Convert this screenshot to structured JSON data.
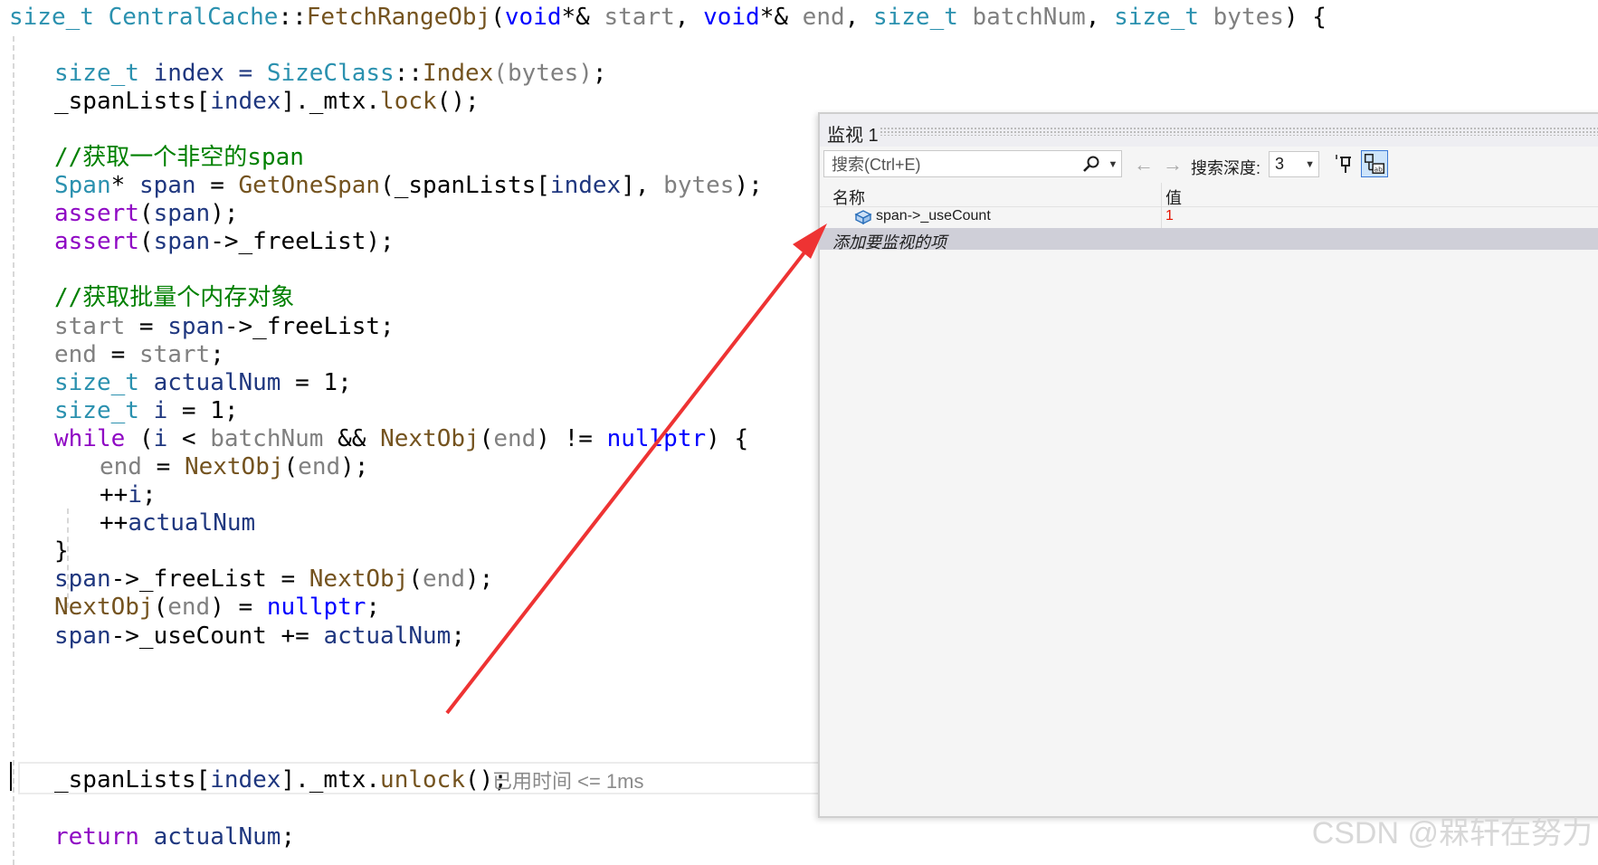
{
  "code": {
    "sig": {
      "ret": "size_t",
      "cls": "CentralCache",
      "sep": "::",
      "fn": "FetchRangeObj",
      "p1t": "void",
      "p1s": "*&",
      "p1n": "start",
      "p2t": "void",
      "p2s": "*&",
      "p2n": "end",
      "p3t": "size_t",
      "p3n": "batchNum",
      "p4t": "size_t",
      "p4n": "bytes",
      "open": "{"
    },
    "l1": {
      "t": "size_t",
      "a": " index = ",
      "cls": "SizeClass",
      "sep": "::",
      "fn": "Index",
      "p": "(bytes)",
      "b": ";"
    },
    "l2": {
      "a": "_spanLists[",
      "idx": "index",
      "b": "]._mtx.",
      "fn": "lock",
      "c": "();"
    },
    "l3": {
      "cm": "//获取一个非空的span"
    },
    "l4": {
      "t": "Span",
      "a": "* ",
      "v": "span",
      "b": " = ",
      "fn": "GetOneSpan",
      "c": "(_spanLists[",
      "idx": "index",
      "d": "], ",
      "p": "bytes",
      "e": ");"
    },
    "l5": {
      "m": "assert",
      "a": "(",
      "v": "span",
      "b": ");"
    },
    "l6": {
      "m": "assert",
      "a": "(",
      "v": "span",
      "b": "->_freeList);"
    },
    "l7": {
      "cm": "//获取批量个内存对象"
    },
    "l8": {
      "p": "start",
      "a": " = ",
      "v": "span",
      "b": "->_freeList;"
    },
    "l9": {
      "p": "end",
      "a": " = ",
      "p2": "start",
      "b": ";"
    },
    "l10": {
      "t": "size_t",
      "a": " ",
      "v": "actualNum",
      "b": " = 1;"
    },
    "l11": {
      "t": "size_t",
      "a": " ",
      "v": "i",
      "b": " = 1;"
    },
    "l12": {
      "k": "while",
      "a": " (",
      "v": "i",
      "b": " < ",
      "p": "batchNum",
      "c": " && ",
      "fn": "NextObj",
      "d": "(",
      "p2": "end",
      "e": ") != ",
      "kw": "nullptr",
      "f": ") {"
    },
    "l13": {
      "p": "end",
      "a": " = ",
      "fn": "NextObj",
      "b": "(",
      "p2": "end",
      "c": ");"
    },
    "l14": {
      "a": "++",
      "v": "i",
      "b": ";"
    },
    "l15": {
      "a": "++",
      "v": "actualNum",
      "b": ";"
    },
    "l16": {
      "a": "}"
    },
    "l17": {
      "v": "span",
      "a": "->_freeList = ",
      "fn": "NextObj",
      "b": "(",
      "p": "end",
      "c": ");"
    },
    "l18": {
      "fn": "NextObj",
      "a": "(",
      "p": "end",
      "b": ") = ",
      "kw": "nullptr",
      "c": ";"
    },
    "l19": {
      "v": "span",
      "a": "->_useCount += ",
      "v2": "actualNum",
      "b": ";"
    },
    "l20": {
      "a": "_spanLists[",
      "idx": "index",
      "b": "]._mtx.",
      "fn": "unlock",
      "c": "();"
    },
    "l21": {
      "k": "return",
      "a": " ",
      "v": "actualNum",
      "b": ";"
    },
    "elapsed": "已用时间 <= 1ms"
  },
  "watch": {
    "title": "监视 1",
    "search_placeholder": "搜索(Ctrl+E)",
    "back_icon": "←",
    "forward_icon": "→",
    "depth_label": "搜索深度:",
    "depth_value": "3",
    "col_name": "名称",
    "col_value": "值",
    "rows": [
      {
        "name": "span->_useCount",
        "value": "1",
        "value_color": "#e51400"
      }
    ],
    "add_item": "添加要监视的项"
  },
  "watermark": "CSDN @槑轩在努力",
  "colors": {
    "type": "#2b91af",
    "keyword": "#0000ff",
    "macro": "#8f08c4",
    "function": "#74531f",
    "param": "#808080",
    "local": "#1f377f",
    "comment": "#008000",
    "arrow": "#ee3333"
  }
}
